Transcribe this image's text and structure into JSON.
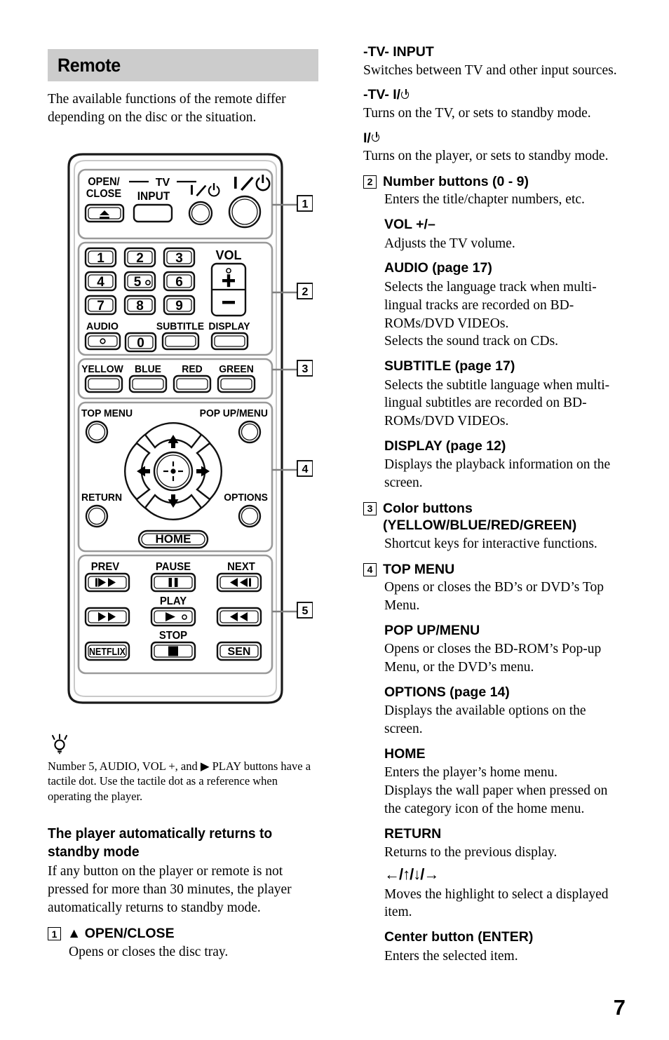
{
  "section": {
    "title": "Remote",
    "intro": "The available functions of the remote differ depending on the disc or the situation."
  },
  "remote_diagram": {
    "callouts": [
      "1",
      "2",
      "3",
      "4",
      "5"
    ],
    "group1": {
      "open_close": "OPEN/\nCLOSE",
      "open_close_line1": "OPEN/",
      "open_close_line2": "CLOSE",
      "tv_label": "TV",
      "tv_input": "INPUT"
    },
    "group2": {
      "numbers": [
        "1",
        "2",
        "3",
        "4",
        "5",
        "6",
        "7",
        "8",
        "9"
      ],
      "zero": "0",
      "vol": "VOL",
      "vol_plus": "+",
      "vol_minus": "−",
      "audio": "AUDIO",
      "subtitle": "SUBTITLE",
      "display": "DISPLAY"
    },
    "group3": {
      "colors": [
        "YELLOW",
        "BLUE",
        "RED",
        "GREEN"
      ]
    },
    "group4": {
      "top_menu": "TOP MENU",
      "pop_up_menu": "POP UP/MENU",
      "return": "RETURN",
      "options": "OPTIONS",
      "home": "HOME"
    },
    "group5": {
      "prev": "PREV",
      "pause": "PAUSE",
      "next": "NEXT",
      "play": "PLAY",
      "stop": "STOP",
      "netflix": "NETFLIX",
      "sen": "SEN"
    }
  },
  "tip": {
    "text": "Number 5, AUDIO, VOL +, and ▶ PLAY buttons have a tactile dot. Use the tactile dot as a reference when operating the player."
  },
  "standby": {
    "heading_line1": "The player automatically returns to",
    "heading_line2": "standby mode",
    "body": "If any button on the player or remote is not pressed for more than 30 minutes, the player automatically returns to standby mode."
  },
  "left_entries": [
    {
      "num": "1",
      "title": "▲ OPEN/CLOSE",
      "body": "Opens or closes the disc tray."
    }
  ],
  "right_entries": [
    {
      "num": "",
      "title": "-TV- INPUT",
      "title_kind": "plain",
      "body": "Switches between TV and other input sources."
    },
    {
      "num": "",
      "title": "-TV- I/⏻",
      "title_kind": "power-tv",
      "body": "Turns on the TV, or sets to standby mode."
    },
    {
      "num": "",
      "title": "I/⏻",
      "title_kind": "power",
      "body": "Turns on the player, or sets to standby mode."
    },
    {
      "num": "2",
      "title": "Number buttons (0 - 9)",
      "title_kind": "plain",
      "body": "Enters the title/chapter numbers, etc."
    },
    {
      "num": "",
      "title": "VOL +/–",
      "title_kind": "plain",
      "body": "Adjusts the TV volume."
    },
    {
      "num": "",
      "title": "AUDIO (page 17)",
      "title_kind": "plain",
      "body": "Selects the language track when multi-lingual tracks are recorded on BD-ROMs/DVD VIDEOs.\nSelects the sound track on CDs."
    },
    {
      "num": "",
      "title": "SUBTITLE (page 17)",
      "title_kind": "plain",
      "body": "Selects the subtitle language when multi-lingual subtitles are recorded on BD-ROMs/DVD VIDEOs."
    },
    {
      "num": "",
      "title": "DISPLAY (page 12)",
      "title_kind": "plain",
      "body": "Displays the playback information on the screen."
    },
    {
      "num": "3",
      "title": "Color buttons (YELLOW/BLUE/RED/GREEN)",
      "title_kind": "plain",
      "body": "Shortcut keys for interactive functions."
    },
    {
      "num": "4",
      "title": "TOP MENU",
      "title_kind": "plain",
      "body": "Opens or closes the BD’s or DVD’s Top Menu."
    },
    {
      "num": "",
      "title": "POP UP/MENU",
      "title_kind": "plain",
      "body": "Opens or closes the BD-ROM’s Pop-up Menu, or the DVD’s menu."
    },
    {
      "num": "",
      "title": "OPTIONS (page 14)",
      "title_kind": "plain",
      "body": "Displays the available options on the screen."
    },
    {
      "num": "",
      "title": "HOME",
      "title_kind": "plain",
      "body": "Enters the player’s home menu.\nDisplays the wall paper when pressed on the category icon of the home menu."
    },
    {
      "num": "",
      "title": "RETURN",
      "title_kind": "plain",
      "body": "Returns to the previous display."
    },
    {
      "num": "",
      "title": "←/↑/↓/→",
      "title_kind": "arrows",
      "body": "Moves the highlight to select a displayed item."
    },
    {
      "num": "",
      "title": "Center button (ENTER)",
      "title_kind": "plain",
      "body": "Enters the selected item."
    }
  ],
  "page_number": "7",
  "colors": {
    "header_bar": "#cccccc",
    "text": "#000000",
    "remote_body_outline": "#1a1a1a",
    "remote_group_outline": "#8c8c8c",
    "leader_line": "#808080"
  }
}
